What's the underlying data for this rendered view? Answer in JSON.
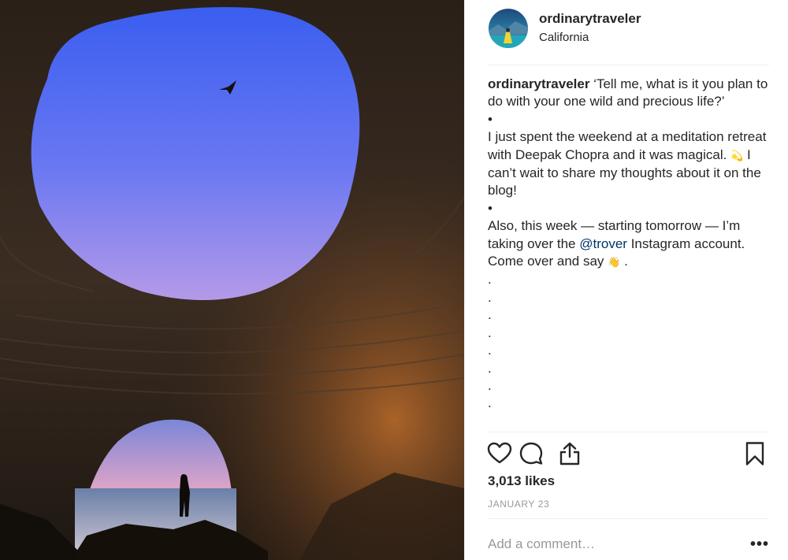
{
  "post": {
    "username": "ordinarytraveler",
    "location": "California",
    "caption": {
      "username": "ordinarytraveler",
      "line1": "‘Tell me, what is it you plan to do with your one wild and precious life?’",
      "bullet": "•",
      "line2a": "I just spent the weekend at a meditation retreat with Deepak Chopra and it was magical.",
      "emoji_sparkle": "💫",
      "line2b": "I can’t wait to share my thoughts about it on the blog!",
      "line3a": "Also, this week — starting tomorrow — I’m taking over the",
      "mention": "@trover",
      "line3b": "Instagram account. Come over and say",
      "emoji_wave": "👋",
      "line3c": ".",
      "trailing_dots": [
        ".",
        ".",
        ".",
        ".",
        ".",
        ".",
        ".",
        "."
      ]
    },
    "likes": "3,013 likes",
    "date": "JANUARY 23",
    "comment_placeholder": "Add a comment…",
    "more_label": "•••"
  },
  "icons": {
    "like": "heart-icon",
    "comment": "comment-bubble-icon",
    "share": "share-icon",
    "save": "bookmark-icon",
    "more": "more-options-icon"
  },
  "colors": {
    "text": "#262626",
    "muted": "#999999",
    "mention": "#003569",
    "divider": "#efefef"
  }
}
